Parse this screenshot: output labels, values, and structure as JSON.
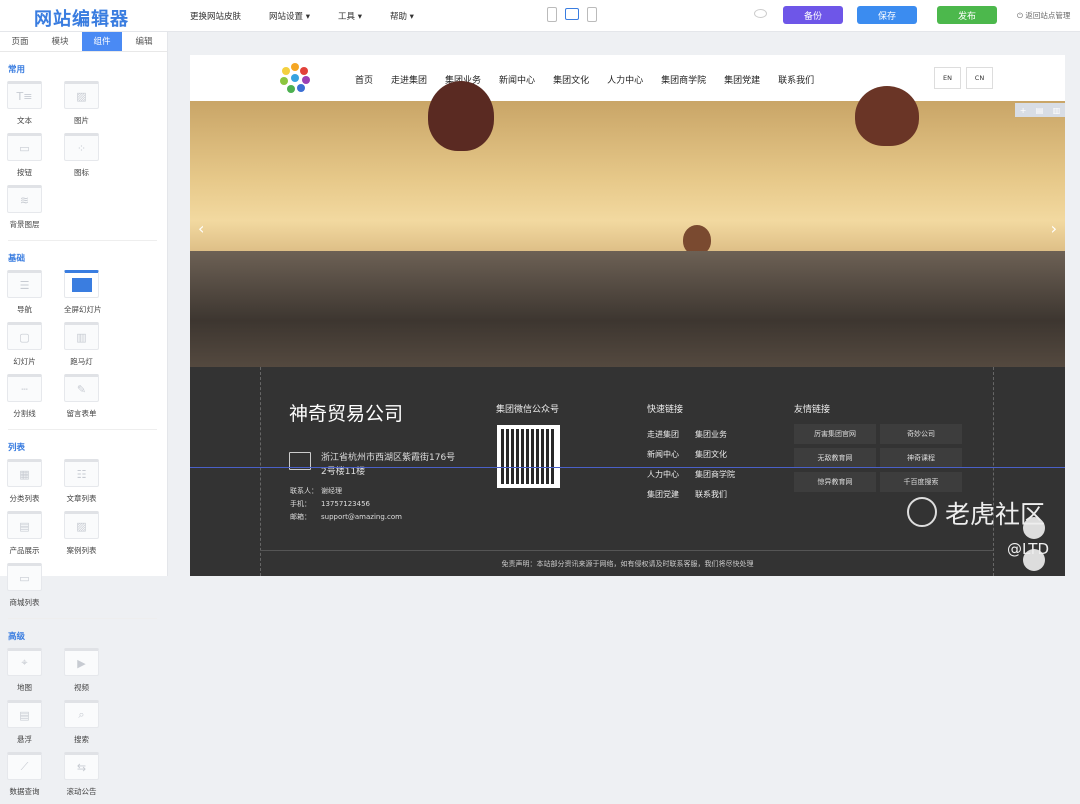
{
  "app": {
    "title": "网站编辑器"
  },
  "menu": [
    "更换网站皮肤",
    "网站设置 ▾",
    "工具 ▾",
    "帮助 ▾"
  ],
  "actions": {
    "backup": "备份",
    "save": "保存",
    "publish": "发布",
    "back": "返回站点管理"
  },
  "colors": {
    "backup": "#6e56e8",
    "save": "#3b8cf0",
    "publish": "#4cb84c"
  },
  "sidebar": {
    "tabs": [
      "页面",
      "模块",
      "组件",
      "编辑"
    ],
    "active_tab": "组件",
    "sections": [
      {
        "title": "常用",
        "items": [
          "文本",
          "图片",
          "按钮",
          "图标",
          "背景图层"
        ]
      },
      {
        "title": "基础",
        "items": [
          "导航",
          "全屏幻灯片",
          "幻灯片",
          "跑马灯",
          "分割线",
          "留言表单"
        ]
      },
      {
        "title": "列表",
        "items": [
          "分类列表",
          "文章列表",
          "产品展示",
          "案例列表",
          "商城列表"
        ]
      },
      {
        "title": "高级",
        "items": [
          "地图",
          "视频",
          "悬浮",
          "搜索",
          "数据查询",
          "滚动公告"
        ]
      }
    ]
  },
  "site": {
    "nav": [
      "首页",
      "走进集团",
      "集团业务",
      "新闻中心",
      "集团文化",
      "人力中心",
      "集团商学院",
      "集团党建",
      "联系我们"
    ],
    "lang": [
      "EN",
      "CN"
    ],
    "footer": {
      "company": "神奇贸易公司",
      "address": "浙江省杭州市西湖区紫霞街176号2号楼11楼",
      "contact_label": "联系人：",
      "contact": "谢经理",
      "phone_label": "手机：",
      "phone": "13757123456",
      "email_label": "邮箱：",
      "email": "support@amazing.com",
      "wechat_title": "集团微信公众号",
      "quick_title": "快速链接",
      "quick_links": [
        "走进集团",
        "集团业务",
        "新闻中心",
        "集团文化",
        "人力中心",
        "集团商学院",
        "集团党建",
        "联系我们"
      ],
      "friend_title": "友情链接",
      "friend_links": [
        "厉害集团官网",
        "奇妙公司",
        "无敌教育网",
        "神奇课程",
        "惊异教育网",
        "千百度搜索"
      ],
      "disclaimer": "免责声明：本站部分资讯来源于网络，如有侵权请及时联系客服，我们将尽快处理"
    }
  },
  "watermark": {
    "text": "老虎社区",
    "handle": "@LTD"
  }
}
